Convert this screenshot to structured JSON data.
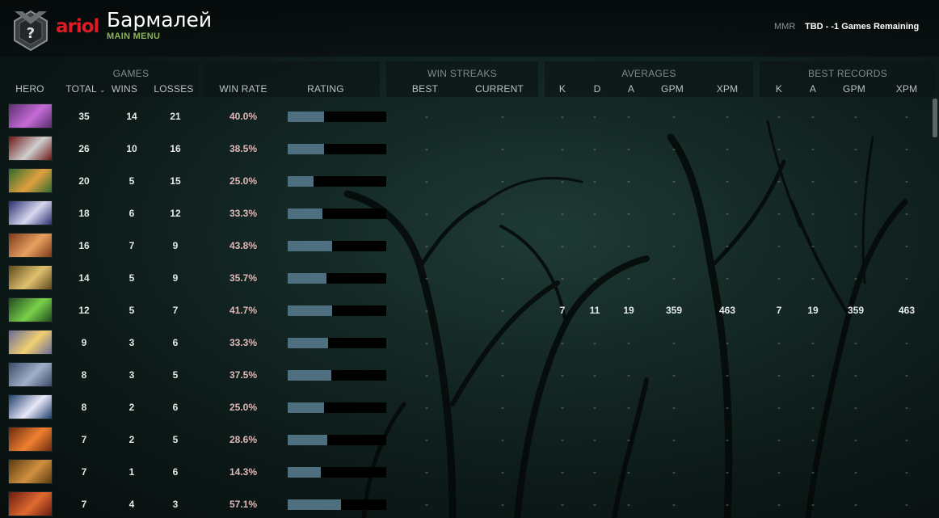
{
  "header": {
    "brand": "ariol",
    "player_name": "Бармалей",
    "main_menu": "MAIN MENU",
    "mmr_label": "MMR",
    "mmr_value": "TBD - -1 Games Remaining"
  },
  "groups": {
    "games": "GAMES",
    "win_streaks": "WIN STREAKS",
    "averages": "AVERAGES",
    "best_records": "BEST RECORDS"
  },
  "columns": {
    "hero": "HERO",
    "total": "TOTAL",
    "wins": "WINS",
    "losses": "LOSSES",
    "win_rate": "WIN RATE",
    "rating": "RATING",
    "streak_best": "BEST",
    "streak_current": "CURRENT",
    "avg_k": "K",
    "avg_d": "D",
    "avg_a": "A",
    "avg_gpm": "GPM",
    "avg_xpm": "XPM",
    "best_k": "K",
    "best_a": "A",
    "best_gpm": "GPM",
    "best_xpm": "XPM"
  },
  "colors": {
    "rating_fill": "#4d6f80",
    "win_rate_text": "#e0b8b8",
    "main_menu": "#8db35a",
    "brand": "#e01b24"
  },
  "rows": [
    {
      "hero_icon": "hero-portrait-purple-assassin",
      "c1": "#5a2f6e",
      "c2": "#c46bd6",
      "total": "35",
      "wins": "14",
      "losses": "21",
      "win_rate": "40.0%",
      "rating": 0.37,
      "streak_best": "-",
      "streak_current": "-",
      "avg_k": "-",
      "avg_d": "-",
      "avg_a": "-",
      "avg_gpm": "-",
      "avg_xpm": "-",
      "best_k": "-",
      "best_a": "-",
      "best_gpm": "-",
      "best_xpm": "-"
    },
    {
      "hero_icon": "hero-portrait-red-queen",
      "c1": "#6e1818",
      "c2": "#cfcfcf",
      "total": "26",
      "wins": "10",
      "losses": "16",
      "win_rate": "38.5%",
      "rating": 0.37,
      "streak_best": "-",
      "streak_current": "-",
      "avg_k": "-",
      "avg_d": "-",
      "avg_a": "-",
      "avg_gpm": "-",
      "avg_xpm": "-",
      "best_k": "-",
      "best_a": "-",
      "best_gpm": "-",
      "best_xpm": "-"
    },
    {
      "hero_icon": "hero-portrait-green-archer",
      "c1": "#2f6b2a",
      "c2": "#e0a040",
      "total": "20",
      "wins": "5",
      "losses": "15",
      "win_rate": "25.0%",
      "rating": 0.26,
      "streak_best": "-",
      "streak_current": "-",
      "avg_k": "-",
      "avg_d": "-",
      "avg_a": "-",
      "avg_gpm": "-",
      "avg_xpm": "-",
      "best_k": "-",
      "best_a": "-",
      "best_gpm": "-",
      "best_xpm": "-"
    },
    {
      "hero_icon": "hero-portrait-blue-moon",
      "c1": "#2b2f6e",
      "c2": "#d8d8f0",
      "total": "18",
      "wins": "6",
      "losses": "12",
      "win_rate": "33.3%",
      "rating": 0.35,
      "streak_best": "-",
      "streak_current": "-",
      "avg_k": "-",
      "avg_d": "-",
      "avg_a": "-",
      "avg_gpm": "-",
      "avg_xpm": "-",
      "best_k": "-",
      "best_a": "-",
      "best_gpm": "-",
      "best_xpm": "-"
    },
    {
      "hero_icon": "hero-portrait-orange-brute",
      "c1": "#7a3a1a",
      "c2": "#e8a060",
      "total": "16",
      "wins": "7",
      "losses": "9",
      "win_rate": "43.8%",
      "rating": 0.45,
      "streak_best": "-",
      "streak_current": "-",
      "avg_k": "-",
      "avg_d": "-",
      "avg_a": "-",
      "avg_gpm": "-",
      "avg_xpm": "-",
      "best_k": "-",
      "best_a": "-",
      "best_gpm": "-",
      "best_xpm": "-"
    },
    {
      "hero_icon": "hero-portrait-gold-monkey",
      "c1": "#5e4a1a",
      "c2": "#e0c070",
      "total": "14",
      "wins": "5",
      "losses": "9",
      "win_rate": "35.7%",
      "rating": 0.39,
      "streak_best": "-",
      "streak_current": "-",
      "avg_k": "-",
      "avg_d": "-",
      "avg_a": "-",
      "avg_gpm": "-",
      "avg_xpm": "-",
      "best_k": "-",
      "best_a": "-",
      "best_gpm": "-",
      "best_xpm": "-"
    },
    {
      "hero_icon": "hero-portrait-green-assassin",
      "c1": "#1f4a1f",
      "c2": "#7ad04a",
      "total": "12",
      "wins": "5",
      "losses": "7",
      "win_rate": "41.7%",
      "rating": 0.45,
      "streak_best": "-",
      "streak_current": "-",
      "avg_k": "7",
      "avg_d": "11",
      "avg_a": "19",
      "avg_gpm": "359",
      "avg_xpm": "463",
      "best_k": "7",
      "best_a": "19",
      "best_gpm": "359",
      "best_xpm": "463"
    },
    {
      "hero_icon": "hero-portrait-sky-knight",
      "c1": "#6a6a9a",
      "c2": "#f0d070",
      "total": "9",
      "wins": "3",
      "losses": "6",
      "win_rate": "33.3%",
      "rating": 0.41,
      "streak_best": "-",
      "streak_current": "-",
      "avg_k": "-",
      "avg_d": "-",
      "avg_a": "-",
      "avg_gpm": "-",
      "avg_xpm": "-",
      "best_k": "-",
      "best_a": "-",
      "best_gpm": "-",
      "best_xpm": "-"
    },
    {
      "hero_icon": "hero-portrait-steel-golem",
      "c1": "#3a4a6a",
      "c2": "#a0b0c8",
      "total": "8",
      "wins": "3",
      "losses": "5",
      "win_rate": "37.5%",
      "rating": 0.44,
      "streak_best": "-",
      "streak_current": "-",
      "avg_k": "-",
      "avg_d": "-",
      "avg_a": "-",
      "avg_gpm": "-",
      "avg_xpm": "-",
      "best_k": "-",
      "best_a": "-",
      "best_gpm": "-",
      "best_xpm": "-"
    },
    {
      "hero_icon": "hero-portrait-ice-maiden",
      "c1": "#1f3f6a",
      "c2": "#e8e8f8",
      "total": "8",
      "wins": "2",
      "losses": "6",
      "win_rate": "25.0%",
      "rating": 0.37,
      "streak_best": "-",
      "streak_current": "-",
      "avg_k": "-",
      "avg_d": "-",
      "avg_a": "-",
      "avg_gpm": "-",
      "avg_xpm": "-",
      "best_k": "-",
      "best_a": "-",
      "best_gpm": "-",
      "best_xpm": "-"
    },
    {
      "hero_icon": "hero-portrait-anti-mage",
      "c1": "#6a2a10",
      "c2": "#f08030",
      "total": "7",
      "wins": "2",
      "losses": "5",
      "win_rate": "28.6%",
      "rating": 0.4,
      "streak_best": "-",
      "streak_current": "-",
      "avg_k": "-",
      "avg_d": "-",
      "avg_a": "-",
      "avg_gpm": "-",
      "avg_xpm": "-",
      "best_k": "-",
      "best_a": "-",
      "best_gpm": "-",
      "best_xpm": "-"
    },
    {
      "hero_icon": "hero-portrait-bronze-warrior",
      "c1": "#5a3a10",
      "c2": "#d09040",
      "total": "7",
      "wins": "1",
      "losses": "6",
      "win_rate": "14.3%",
      "rating": 0.34,
      "streak_best": "-",
      "streak_current": "-",
      "avg_k": "-",
      "avg_d": "-",
      "avg_a": "-",
      "avg_gpm": "-",
      "avg_xpm": "-",
      "best_k": "-",
      "best_a": "-",
      "best_gpm": "-",
      "best_xpm": "-"
    },
    {
      "hero_icon": "hero-portrait-red-brawler",
      "c1": "#6a1a10",
      "c2": "#e06a30",
      "total": "7",
      "wins": "4",
      "losses": "3",
      "win_rate": "57.1%",
      "rating": 0.54,
      "streak_best": "-",
      "streak_current": "-",
      "avg_k": "-",
      "avg_d": "-",
      "avg_a": "-",
      "avg_gpm": "-",
      "avg_xpm": "-",
      "best_k": "-",
      "best_a": "-",
      "best_gpm": "-",
      "best_xpm": "-"
    }
  ]
}
